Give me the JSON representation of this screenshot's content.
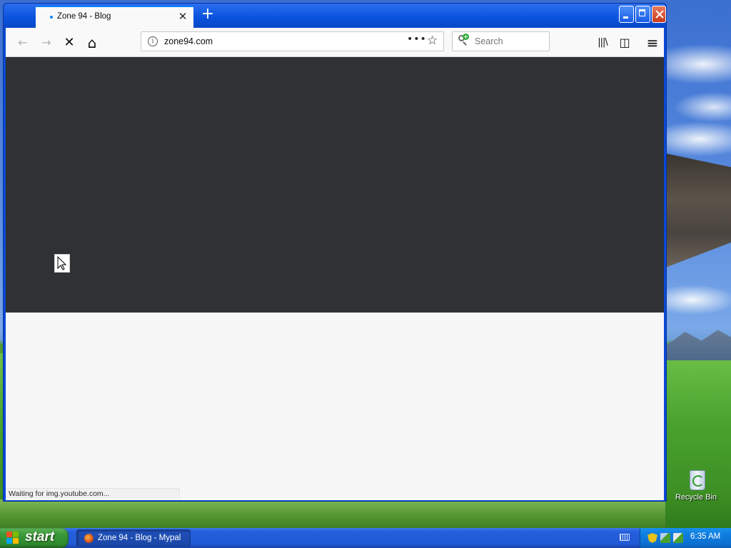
{
  "browser": {
    "tab": {
      "title": "Zone 94 - Blog",
      "close_glyph": "✕"
    },
    "new_tab_glyph": "+",
    "toolbar": {
      "back_glyph": "←",
      "forward_glyph": "→",
      "stop_glyph": "✕",
      "home_glyph": "⌂",
      "url": "zone94.com",
      "page_actions_glyph": "•••",
      "bookmark_glyph": "☆",
      "search_placeholder": "Search",
      "library_glyph": "|||\\",
      "sidebar_glyph": "◫",
      "menu_glyph": "≡"
    },
    "status_text": "Waiting for img.youtube.com..."
  },
  "desktop": {
    "recycle_bin_label": "Recycle Bin"
  },
  "taskbar": {
    "start_label": "start",
    "task_item_label": "Zone 94 - Blog - Mypal",
    "clock": "6:35 AM"
  },
  "colors": {
    "content_dark": "#2f3134",
    "content_light": "#f7f7f8",
    "xp_blue": "#245edb",
    "start_green": "#3c9a3a"
  },
  "icons": [
    "back-arrow-icon",
    "forward-arrow-icon",
    "stop-icon",
    "home-icon",
    "site-info-icon",
    "page-actions-icon",
    "bookmark-star-icon",
    "search-icon",
    "library-icon",
    "sidebar-icon",
    "menu-icon",
    "recycle-bin-icon",
    "windows-logo-icon",
    "mypal-icon",
    "keyboard-icon",
    "security-shield-icon",
    "network-icon",
    "volume-icon",
    "mouse-cursor-icon"
  ]
}
